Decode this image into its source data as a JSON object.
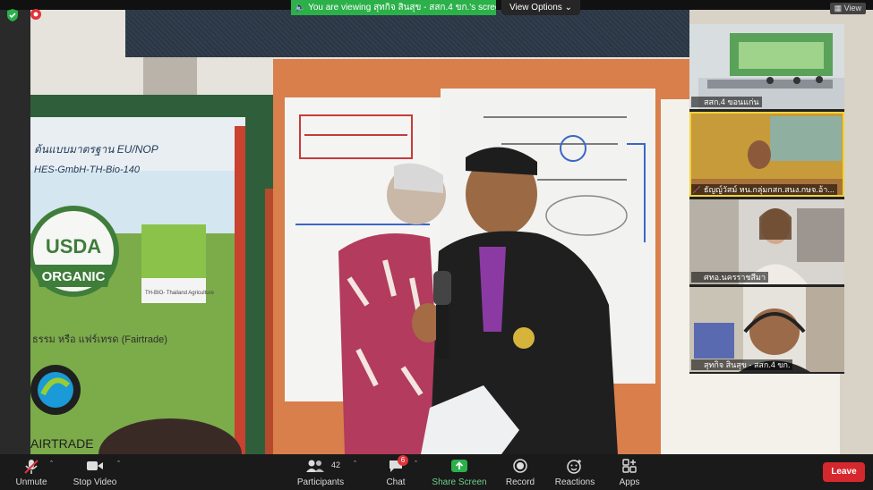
{
  "banner": {
    "viewing_text": "You are viewing สุทกิจ สินสุข - สสก.4 ขก.'s screen",
    "view_options_label": "View Options",
    "view_top_label": "View"
  },
  "gallery": {
    "participants": [
      {
        "name": "สสก.4 ขอนแก่น",
        "muted": false
      },
      {
        "name": "ธัญญ์วัสม์ หน.กลุ่มกสก.สนง.กษจ.อ้า...",
        "muted": true
      },
      {
        "name": "ศทอ.นครราชสีมา",
        "muted": true
      },
      {
        "name": "สุทกิจ สินสุข - สสก.4 ขก.",
        "muted": true
      }
    ]
  },
  "shared_screen": {
    "banner_text_1": "USDA",
    "banner_text_2": "ORGANIC",
    "banner_text_3": "AIRTRADE",
    "banner_text_4": "ต้นแบบมาตรฐาน EU/NOP",
    "banner_text_5": "HES-GmbH-TH-Bio-140",
    "banner_text_6": "ธรรม หรือ แฟร์เทรด (Fairtrade)",
    "eu_label": "TH-BIO-\nThailand Agriculture"
  },
  "toolbar": {
    "unmute_label": "Unmute",
    "stop_video_label": "Stop Video",
    "participants_label": "Participants",
    "participants_count": "42",
    "chat_label": "Chat",
    "chat_badge": "6",
    "share_screen_label": "Share Screen",
    "record_label": "Record",
    "reactions_label": "Reactions",
    "apps_label": "Apps",
    "leave_label": "Leave"
  },
  "colors": {
    "share_green": "#2bb04a",
    "leave_red": "#d5282e",
    "active_speaker": "#f2d13b"
  }
}
